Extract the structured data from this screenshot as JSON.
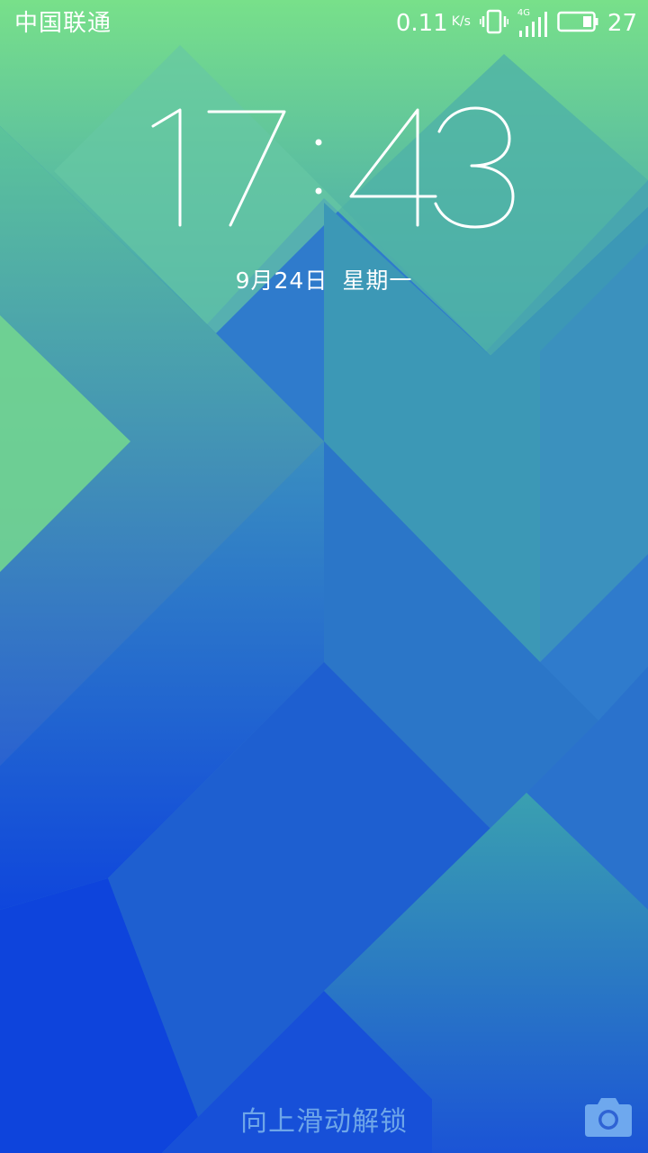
{
  "status_bar": {
    "carrier": "中国联通",
    "net_speed": "0.11",
    "net_speed_unit": "K/s",
    "network_type": "4G",
    "battery_level": "27",
    "icons": [
      "vibrate-icon",
      "signal-icon",
      "battery-icon"
    ]
  },
  "clock": {
    "hours": "17",
    "minutes": "43"
  },
  "date": {
    "day": "9月24日",
    "weekday": "星期一"
  },
  "unlock_hint": "向上滑动解锁",
  "camera": {
    "icon": "camera-icon"
  },
  "colors": {
    "accent": "#ffffff",
    "wallpaper_top": "#6ad889",
    "wallpaper_bottom": "#1045de",
    "hint_text": "#78afeb",
    "camera_icon": "#6ea8ee"
  }
}
